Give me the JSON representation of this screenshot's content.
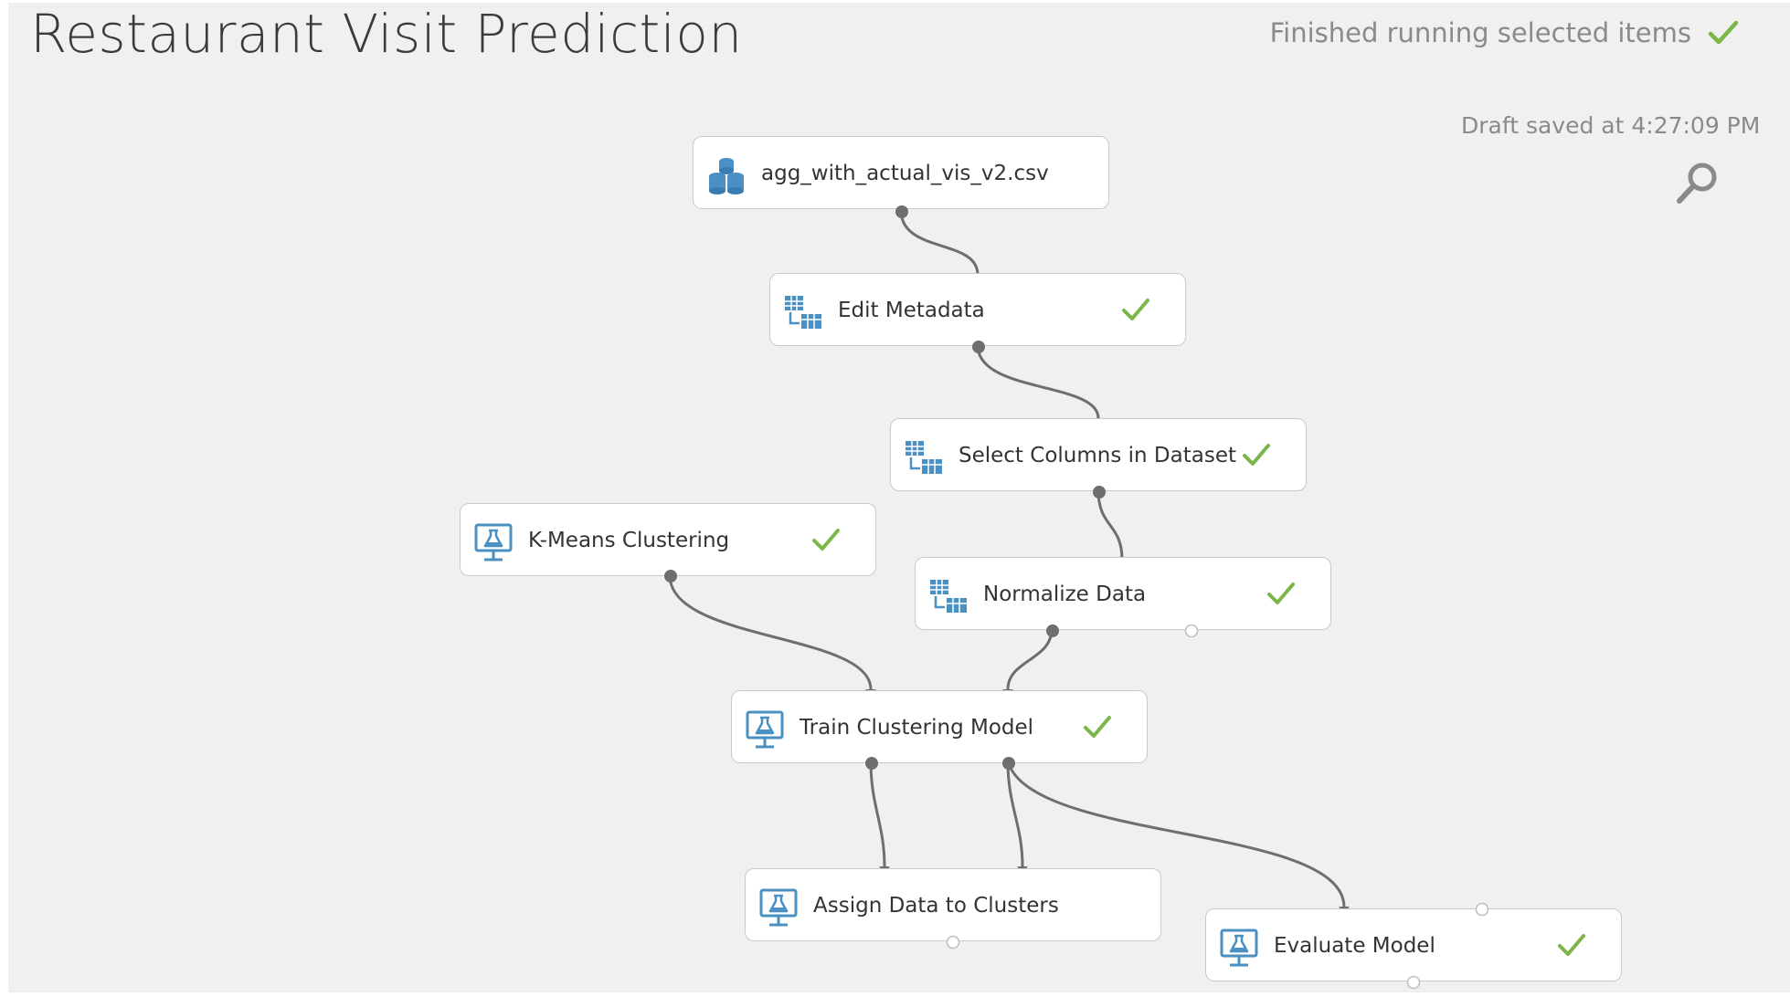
{
  "experiment": {
    "title": "Restaurant Visit Prediction",
    "status_text": "Finished running selected items",
    "draft_text": "Draft saved at 4:27:09 PM"
  },
  "colors": {
    "canvas": "#f0f0f0",
    "node_bg": "#ffffff",
    "node_border": "#c9c9c9",
    "check": "#7ab648",
    "icon_blue": "#4a90c2",
    "wire": "#6e6e6e"
  },
  "nodes": [
    {
      "label": "agg_with_actual_vis_v2.csv",
      "icon": "dataset-icon",
      "completed": false
    },
    {
      "label": "Edit Metadata",
      "icon": "data-transform-icon",
      "completed": true
    },
    {
      "label": "Select Columns in Dataset",
      "icon": "data-transform-icon",
      "completed": true
    },
    {
      "label": "K-Means Clustering",
      "icon": "machine-learning-icon",
      "completed": true
    },
    {
      "label": "Normalize Data",
      "icon": "data-transform-icon",
      "completed": true
    },
    {
      "label": "Train Clustering Model",
      "icon": "machine-learning-icon",
      "completed": true
    },
    {
      "label": "Assign Data to Clusters",
      "icon": "machine-learning-icon",
      "completed": false
    },
    {
      "label": "Evaluate Model",
      "icon": "machine-learning-icon",
      "completed": true
    }
  ]
}
